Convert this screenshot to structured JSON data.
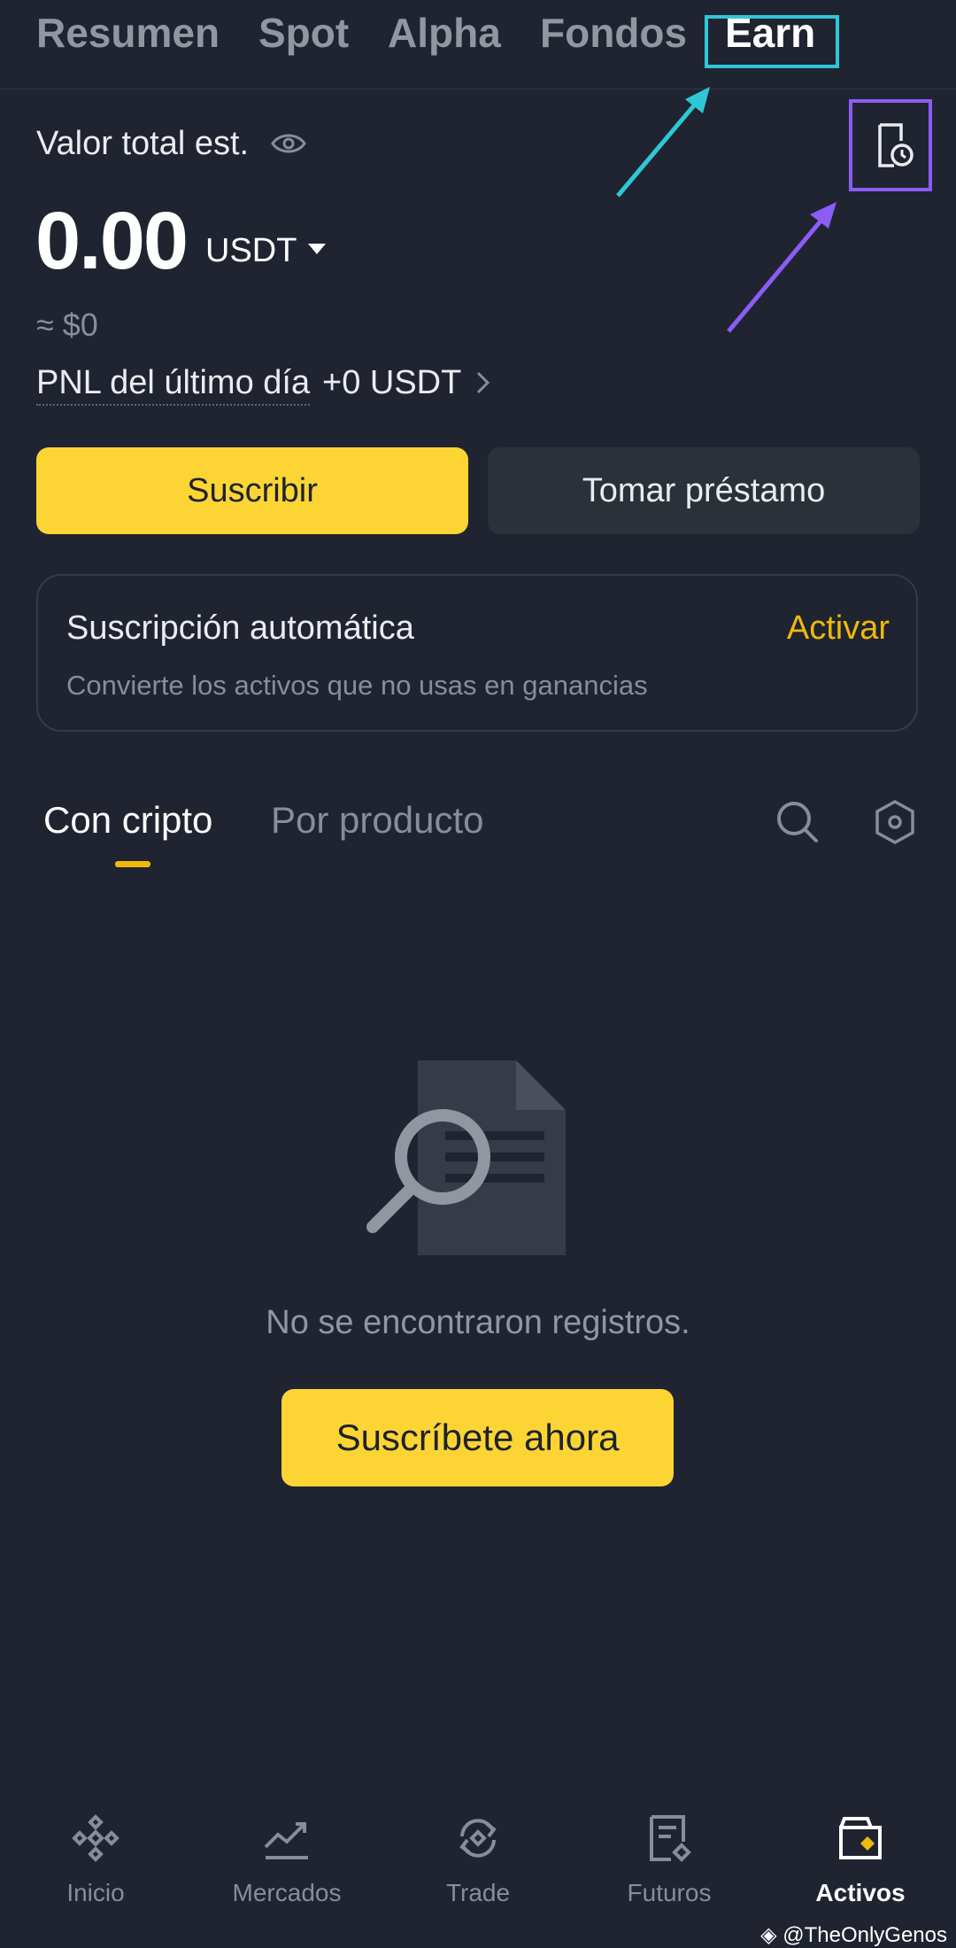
{
  "top_tabs": [
    "Resumen",
    "Spot",
    "Alpha",
    "Fondos",
    "Earn"
  ],
  "header": {
    "value_label": "Valor total est.",
    "balance": "0.00",
    "currency": "USDT",
    "usd_approx": "≈ $0",
    "pnl_label": "PNL del último día",
    "pnl_value": "+0 USDT"
  },
  "actions": {
    "subscribe": "Suscribir",
    "borrow": "Tomar préstamo"
  },
  "auto_subscription": {
    "title": "Suscripción automática",
    "activate": "Activar",
    "description": "Convierte los activos que no usas en ganancias"
  },
  "sub_tabs": [
    "Con cripto",
    "Por producto"
  ],
  "empty": {
    "message": "No se encontraron registros.",
    "cta": "Suscríbete ahora"
  },
  "bottom_nav": [
    "Inicio",
    "Mercados",
    "Trade",
    "Futuros",
    "Activos"
  ],
  "watermark": "@TheOnlyGenos",
  "colors": {
    "background": "#1f2430",
    "accent_yellow": "#fcd535",
    "highlight_cyan": "#2ec7d6",
    "highlight_purple": "#8b5cf6"
  }
}
